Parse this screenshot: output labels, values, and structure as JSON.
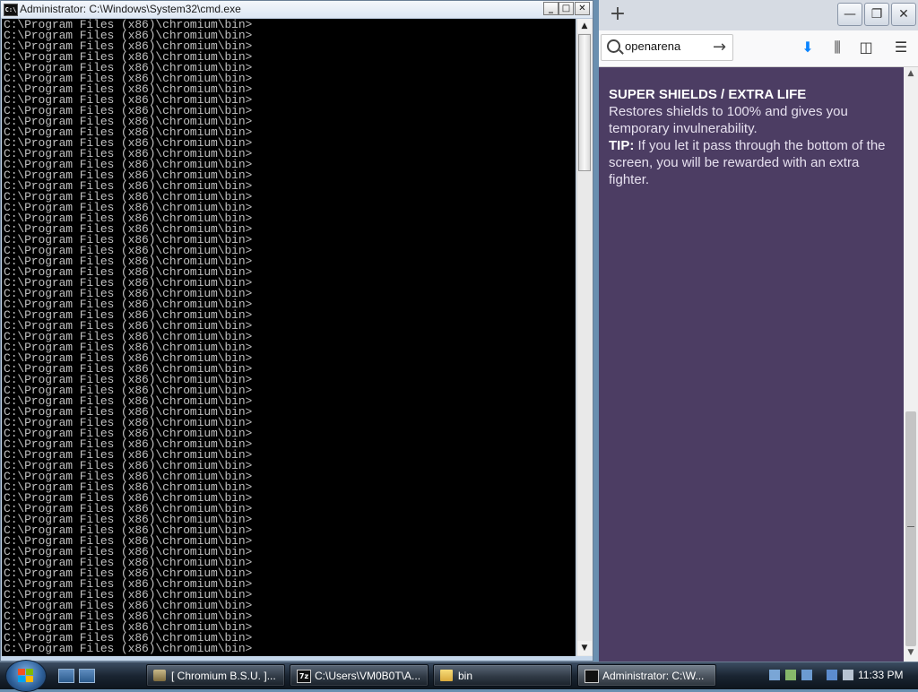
{
  "cmd": {
    "title": "Administrator: C:\\Windows\\System32\\cmd.exe",
    "icon_label": "C:\\",
    "prompt_line": "C:\\Program Files (x86)\\chromium\\bin>",
    "visible_line_count": 59,
    "buttons": {
      "minimize": "_",
      "maximize": "□",
      "close": "✕"
    },
    "scroll": {
      "up": "▲",
      "down": "▼"
    }
  },
  "firefox": {
    "new_tab": "+",
    "window_buttons": {
      "minimize": "—",
      "restore": "❐",
      "close": "✕"
    },
    "search_value": "openarena",
    "go": "→",
    "tools": {
      "download": "⬇",
      "library": "⫼",
      "sidebar": "◫",
      "menu": "☰"
    },
    "content": {
      "heading": "SUPER SHIELDS / EXTRA LIFE",
      "desc": "Restores shields to 100% and gives you temporary invulnerability.",
      "tip_label": "TIP:",
      "tip_text": " If you let it pass through the bottom of the screen, you will be rewarded with an extra fighter."
    },
    "background_color": "#4c3d63",
    "scroll": {
      "up": "▲",
      "down": "▼"
    }
  },
  "taskbar": {
    "tasks": [
      {
        "label": "[ Chromium B.S.U. ]...",
        "icon": "game-icon",
        "active": false
      },
      {
        "label": "C:\\Users\\VM0B0T\\A...",
        "icon": "7zip-icon",
        "active": false
      },
      {
        "label": "bin",
        "icon": "folder-icon",
        "active": false
      },
      {
        "label": "Administrator: C:\\W...",
        "icon": "cmd-icon",
        "active": true
      }
    ],
    "clock": "11:33 PM"
  }
}
